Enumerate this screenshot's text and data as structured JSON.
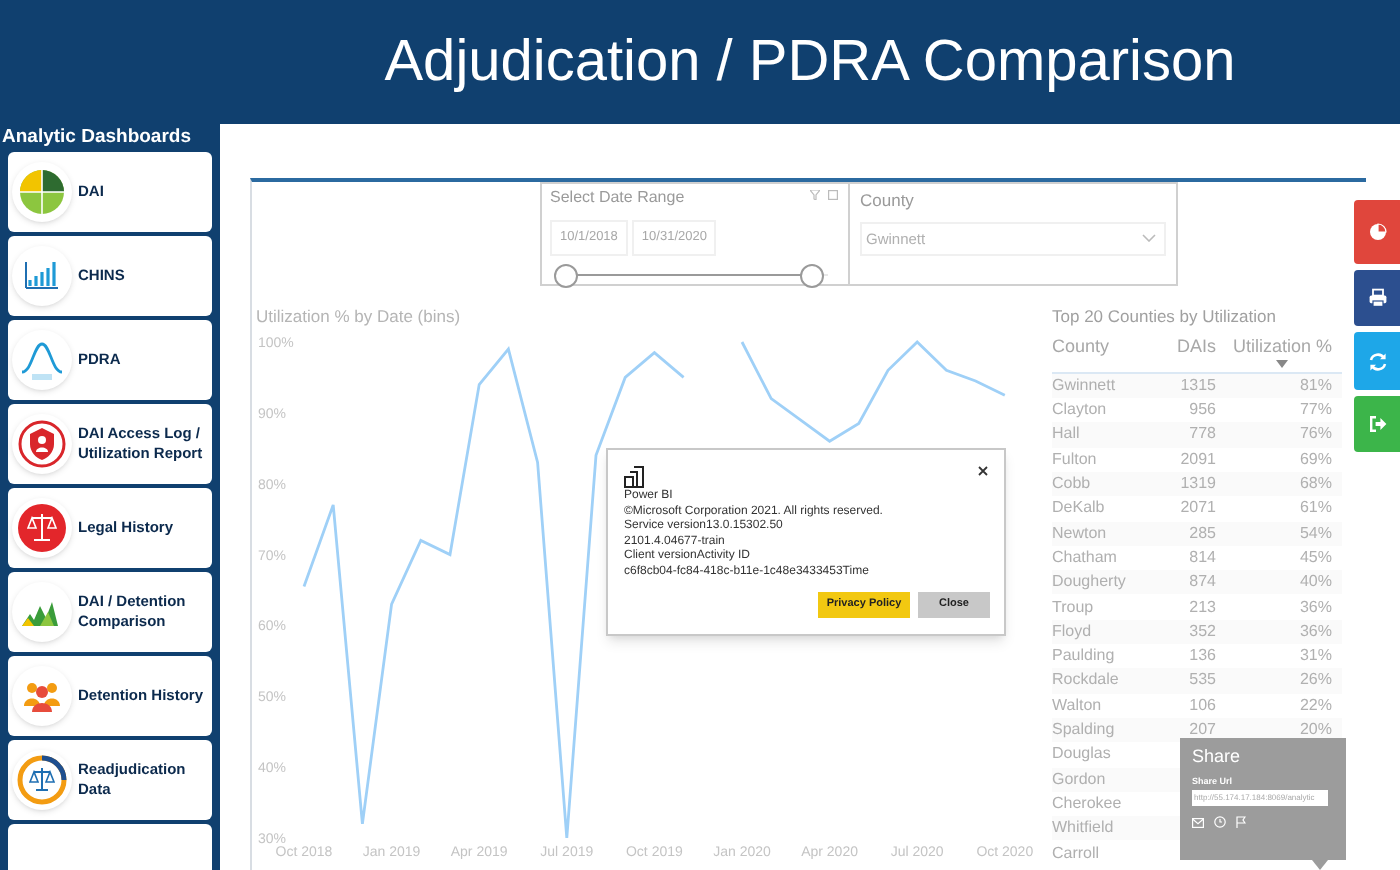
{
  "header": {
    "title": "Adjudication / PDRA Comparison"
  },
  "sidebar": {
    "title": "Analytic Dashboards",
    "items": [
      {
        "label": "DAI",
        "kind": "dai"
      },
      {
        "label": "CHINS",
        "kind": "chins"
      },
      {
        "label": "PDRA",
        "kind": "pdra"
      },
      {
        "label": "DAI Access Log / Utilization Report",
        "kind": "access"
      },
      {
        "label": "Legal History",
        "kind": "legal"
      },
      {
        "label": "DAI / Detention Comparison",
        "kind": "comparison"
      },
      {
        "label": "Detention History",
        "kind": "detention"
      },
      {
        "label": "Readjudication Data",
        "kind": "readjudication"
      }
    ]
  },
  "date_slicer": {
    "title": "Select Date Range",
    "start": "10/1/2018",
    "end": "10/31/2020",
    "level": 1
  },
  "county_slicer": {
    "title": "County",
    "value": "Gwinnett"
  },
  "chart": {
    "chart_data": {
      "type": "line",
      "title": "Utilization % by Date (bins)",
      "categories": [
        "Oct 2018",
        null,
        null,
        "Jan 2019",
        null,
        null,
        "Apr 2019",
        null,
        null,
        "Jul 2019",
        null,
        null,
        "Oct 2019",
        null,
        null,
        "Jan 2020",
        null,
        null,
        "Apr 2020",
        null,
        null,
        "Jul 2020",
        null,
        null,
        "Oct 2020"
      ],
      "yticks": [
        {
          "value": 30,
          "label": "30%"
        },
        {
          "value": 40,
          "label": "40%"
        },
        {
          "value": 50,
          "label": "50%"
        },
        {
          "value": 60,
          "label": "60%"
        },
        {
          "value": 70,
          "label": "70%"
        },
        {
          "value": 80,
          "label": "80%"
        },
        {
          "value": 90,
          "label": "90%"
        },
        {
          "value": 100,
          "label": "100%"
        }
      ],
      "ylim": [
        30,
        100
      ],
      "series": [
        {
          "color": "#9fd0f7",
          "values": [
            65.5,
            77,
            32,
            63,
            72,
            70,
            94,
            99,
            83,
            30,
            84,
            95,
            98.5,
            95,
            null,
            100,
            92,
            89,
            86,
            88.5,
            96,
            100,
            96,
            94.5,
            92.5
          ]
        }
      ]
    }
  },
  "table": {
    "title": "Top 20 Counties by Utilization",
    "columns": [
      {
        "label": "County",
        "sorted": false
      },
      {
        "label": "DAIs",
        "sorted": false
      },
      {
        "label": "Utilization %",
        "sorted": true
      }
    ],
    "rows": [
      {
        "county": "Gwinnett",
        "dais": "1315",
        "utilization": "81%"
      },
      {
        "county": "Clayton",
        "dais": "956",
        "utilization": "77%"
      },
      {
        "county": "Hall",
        "dais": "778",
        "utilization": "76%"
      },
      {
        "county": "Fulton",
        "dais": "2091",
        "utilization": "69%"
      },
      {
        "county": "Cobb",
        "dais": "1319",
        "utilization": "68%"
      },
      {
        "county": "DeKalb",
        "dais": "2071",
        "utilization": "61%"
      },
      {
        "county": "Newton",
        "dais": "285",
        "utilization": "54%"
      },
      {
        "county": "Chatham",
        "dais": "814",
        "utilization": "45%"
      },
      {
        "county": "Dougherty",
        "dais": "874",
        "utilization": "40%"
      },
      {
        "county": "Troup",
        "dais": "213",
        "utilization": "36%"
      },
      {
        "county": "Floyd",
        "dais": "352",
        "utilization": "36%"
      },
      {
        "county": "Paulding",
        "dais": "136",
        "utilization": "31%"
      },
      {
        "county": "Rockdale",
        "dais": "535",
        "utilization": "26%"
      },
      {
        "county": "Walton",
        "dais": "106",
        "utilization": "22%"
      },
      {
        "county": "Spalding",
        "dais": "207",
        "utilization": "20%"
      },
      {
        "county": "Douglas"
      },
      {
        "county": "Gordon"
      },
      {
        "county": "Cherokee"
      },
      {
        "county": "Whitfield"
      },
      {
        "county": "Carroll"
      }
    ]
  },
  "side_buttons": [
    {
      "kind": "chart",
      "color": "#e0463c"
    },
    {
      "kind": "print",
      "color": "#2c4f8f"
    },
    {
      "kind": "refresh",
      "color": "#1ea7e8"
    },
    {
      "kind": "exit",
      "color": "#3cb54a"
    }
  ],
  "dialog": {
    "product": "Power BI",
    "lines": [
      "©Microsoft Corporation 2021. All rights reserved.",
      "Service version13.0.15302.50",
      "2101.4.04677-train",
      "Client versionActivity ID",
      "c6f8cb04-fc84-418c-b11e-1c48e3433453Time"
    ],
    "buttons": [
      {
        "label": "Privacy Policy",
        "kind": "primary"
      },
      {
        "label": "Close",
        "kind": "secondary"
      }
    ]
  },
  "share_popup": {
    "title": "Share",
    "url_label": "Share Url",
    "url": "http://55.174.17.184:8069/analytic"
  }
}
